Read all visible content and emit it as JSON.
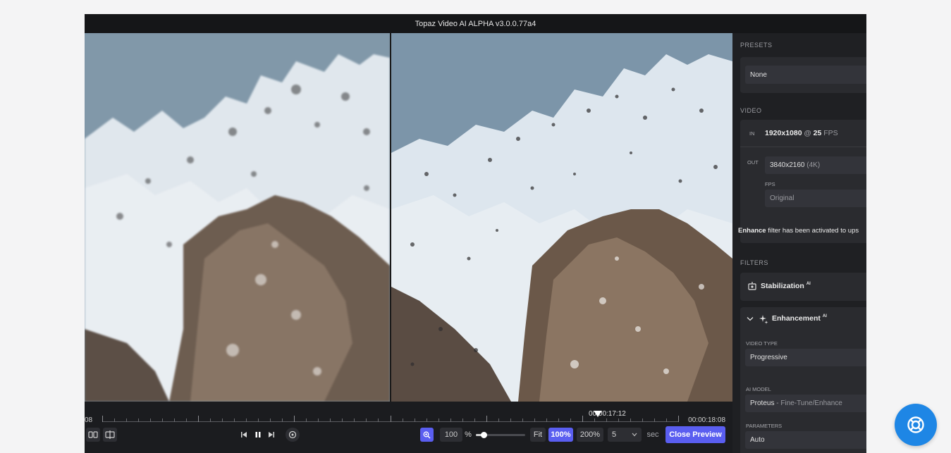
{
  "window": {
    "title": "Topaz Video AI ALPHA  v3.0.0.77a4"
  },
  "timeline": {
    "start_label": "08",
    "current_time": "00:00:17:12",
    "end_time": "00:00:18:08",
    "playhead_fraction": 0.86
  },
  "controls": {
    "view_side_by_side_icon": "split-compare-icon",
    "view_split_icon": "split-view-icon",
    "prev_frame_icon": "step-back-icon",
    "pause_icon": "pause-icon",
    "next_frame_icon": "step-forward-icon",
    "loop_icon": "loop-icon",
    "zoom_icon": "zoom-in-icon",
    "zoom_value": "100",
    "zoom_unit": "%",
    "zoom_fraction": 0.15,
    "fit_label": "Fit",
    "pct100_label": "100%",
    "pct200_label": "200%",
    "preview_duration": "5",
    "preview_unit": "sec",
    "close_preview_label": "Close Preview",
    "accent": "#5a5ef0"
  },
  "sidebar": {
    "presets_label": "PRESETS",
    "preset_value": "None",
    "video_label": "VIDEO",
    "in_label": "IN",
    "in_res": "1920x1080",
    "in_at": "@",
    "in_fps_value": "25",
    "in_fps_unit": "FPS",
    "out_label": "OUT",
    "out_res": "3840x2160",
    "out_res_tag": "(4K)",
    "fps_label": "FPS",
    "fps_value": "Original",
    "enhance_note_bold": "Enhance",
    "enhance_note_rest": "filter has been activated to ups",
    "filters_label": "FILTERS",
    "stabilization_label": "Stabilization",
    "stabilization_sup": "AI",
    "enhancement_label": "Enhancement",
    "enhancement_sup": "AI",
    "video_type_label": "VIDEO TYPE",
    "video_type_value": "Progressive",
    "ai_model_label": "AI MODEL",
    "ai_model_value": "Proteus",
    "ai_model_desc": "- Fine-Tune/Enhance",
    "parameters_label": "PARAMETERS",
    "parameters_value": "Auto"
  },
  "help": {
    "icon": "help-lifebuoy-icon",
    "color": "#1e86e5"
  }
}
